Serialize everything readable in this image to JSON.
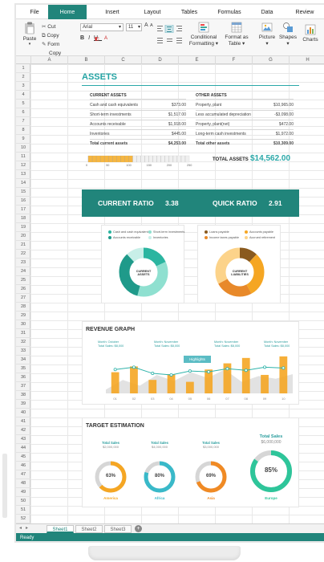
{
  "menu": {
    "tabs": [
      "File",
      "Home",
      "Insert",
      "Layout",
      "Tables",
      "Formulas",
      "Data",
      "Review"
    ],
    "active": "Home"
  },
  "ribbon": {
    "paste_label": "Paste",
    "cut_label": "Cut",
    "copy_label": "Copy",
    "format_label": "Form",
    "format_label2": "Copy",
    "font_name": "Arial",
    "font_size": "11",
    "conditional_label": "Conditional",
    "conditional_label2": "Formatting",
    "format_table_label": "Format as",
    "format_table_label2": "Table",
    "picture_label": "Picture",
    "shapes_label": "Shapes",
    "charts_label": "Charts"
  },
  "grid": {
    "columns": [
      "A",
      "B",
      "C",
      "D",
      "E",
      "F",
      "G",
      "H"
    ],
    "rows": [
      "1",
      "2",
      "3",
      "4",
      "5",
      "6",
      "7",
      "8",
      "9",
      "10",
      "11",
      "12",
      "13",
      "14",
      "15",
      "16",
      "17",
      "18",
      "19",
      "20",
      "21",
      "22",
      "23",
      "24",
      "25",
      "26",
      "27",
      "28",
      "29",
      "30",
      "31",
      "32",
      "33",
      "34",
      "35",
      "36",
      "37",
      "38",
      "39",
      "40",
      "41",
      "42",
      "43",
      "44",
      "45",
      "46",
      "47",
      "48",
      "49",
      "50",
      "51",
      "52"
    ]
  },
  "assets": {
    "title": "ASSETS",
    "current_head": "CURRENT ASSETS",
    "other_head": "OTHER ASSETS",
    "current": [
      {
        "label": "Cash and cash equivalents",
        "value": "$373.00"
      },
      {
        "label": "Short-term investments",
        "value": "$1,517.00"
      },
      {
        "label": "Accounts receivable",
        "value": "$1,918.00"
      },
      {
        "label": "Inventories",
        "value": "$445.00"
      }
    ],
    "current_total_label": "Total current assets",
    "current_total_value": "$4,253.00",
    "other": [
      {
        "label": "Property, plant",
        "value": "$10,965.00"
      },
      {
        "label": "Less accumulated depreciation",
        "value": "-$3,098.00"
      },
      {
        "label": "Property, plant(net)",
        "value": "$472.00"
      },
      {
        "label": "Long-term cash investments",
        "value": "$1,972.00"
      }
    ],
    "other_total_label": "Total other assets",
    "other_total_value": "$10,309.00",
    "progress_ticks": [
      "0",
      "50",
      "100",
      "150",
      "200",
      "250"
    ],
    "progress_value": 0.44,
    "total_assets_label": "TOTAL ASSETS",
    "total_assets_value": "$14,562.00"
  },
  "ratios": {
    "current_label": "CURRENT RATIO",
    "current_value": "3.38",
    "quick_label": "QUICK RATIO",
    "quick_value": "2.91"
  },
  "donuts": {
    "assets_center": [
      "CURRENT",
      "ASSETS"
    ],
    "assets_legend": [
      "Cash and cash equivalents",
      "Short-term investments",
      "Accounts receivable",
      "Inventories"
    ],
    "assets_colors": [
      "#2bb5a0",
      "#8fe0d0",
      "#1f9a8a",
      "#c8efe8"
    ],
    "liab_center": [
      "CURRENT",
      "LIABILITIES"
    ],
    "liab_legend": [
      "Loans payable",
      "Accounts payable",
      "Income taxes payable",
      "Accrued retirement"
    ],
    "liab_colors": [
      "#8a5a1e",
      "#f5a623",
      "#e8892a",
      "#fcd38a"
    ]
  },
  "revenue": {
    "title": "REVENUE GRAPH",
    "badge": "Highlights",
    "notes": [
      {
        "month": "Month: October",
        "sales": "Total Sales: $8,000"
      },
      {
        "month": "Month: November",
        "sales": "Total Sales: $8,000"
      },
      {
        "month": "Month: November",
        "sales": "Total Sales: $8,000"
      },
      {
        "month": "Month: November",
        "sales": "Total Sales: $8,000"
      }
    ],
    "x_labels": [
      "01",
      "02",
      "03",
      "04",
      "05",
      "06",
      "07",
      "08",
      "09",
      "10"
    ]
  },
  "chart_data": {
    "type": "bar",
    "categories": [
      "01",
      "02",
      "03",
      "04",
      "05",
      "06",
      "07",
      "08",
      "09",
      "10"
    ],
    "series": [
      {
        "values": [
          55,
          70,
          35,
          50,
          30,
          62,
          78,
          92,
          48,
          96
        ]
      },
      {
        "values": [
          62,
          68,
          52,
          48,
          58,
          56,
          64,
          60,
          68,
          66
        ]
      }
    ],
    "ylim": [
      0,
      100
    ],
    "title": "REVENUE GRAPH"
  },
  "targets": {
    "title": "TARGET ESTIMATION",
    "items": [
      {
        "head": "Total Sales",
        "sub": "$2,000,000",
        "pct": "63%",
        "value": 0.63,
        "region": "America",
        "color": "#f5a623"
      },
      {
        "head": "Total Sales",
        "sub": "$4,000,000",
        "pct": "80%",
        "value": 0.8,
        "region": "Africa",
        "color": "#39b9c9"
      },
      {
        "head": "Total Sales",
        "sub": "$3,000,000",
        "pct": "69%",
        "value": 0.69,
        "region": "Asia",
        "color": "#f08a24"
      },
      {
        "head": "Total Sales",
        "sub": "$6,000,000",
        "pct": "85%",
        "value": 0.85,
        "region": "Europe",
        "color": "#2ec59a"
      }
    ]
  },
  "sheets": [
    "Sheet1",
    "Sheet2",
    "Sheet3"
  ],
  "status": "Ready"
}
